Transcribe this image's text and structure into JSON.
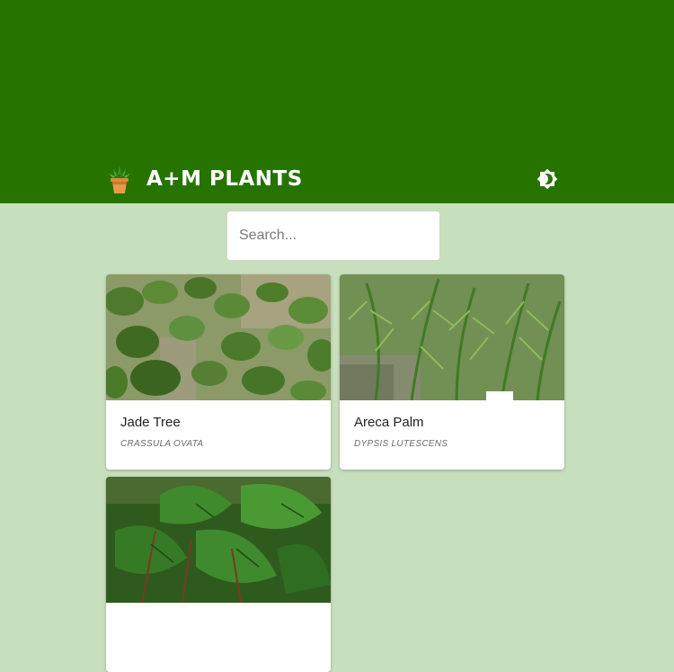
{
  "header": {
    "brand_name": "A+M PLANTS",
    "logo_icon": "potted-cactus-icon",
    "theme_toggle_icon": "brightness-icon",
    "background_color": "#267300"
  },
  "search": {
    "placeholder": "Search...",
    "value": ""
  },
  "plants": [
    {
      "name": "Jade Tree",
      "scientific_name": "CRASSULA OVATA"
    },
    {
      "name": "Areca Palm",
      "scientific_name": "DYPSIS LUTESCENS"
    },
    {
      "name": "",
      "scientific_name": ""
    }
  ],
  "page_background": "#c8dfbd"
}
